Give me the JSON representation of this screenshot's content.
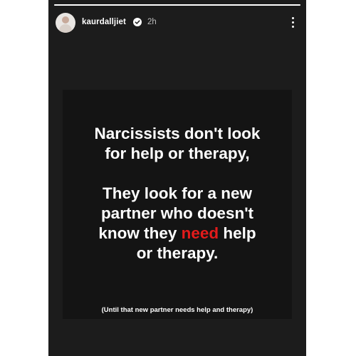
{
  "story": {
    "username": "kaurdalljiet",
    "timestamp": "2h",
    "verified_icon": "verified-badge-icon",
    "menu_icon": "more-options-icon"
  },
  "post": {
    "line1": "Narcissists don't look",
    "line2": "for help or therapy,",
    "line3": "They look for a new",
    "line4": "partner who doesn't",
    "line5_before": "know they ",
    "line5_highlight": "need",
    "line5_after": " help",
    "line6": "or therapy.",
    "footnote": "(Until that new partner needs help and therapy)",
    "highlight_color": "#e31b1b"
  }
}
